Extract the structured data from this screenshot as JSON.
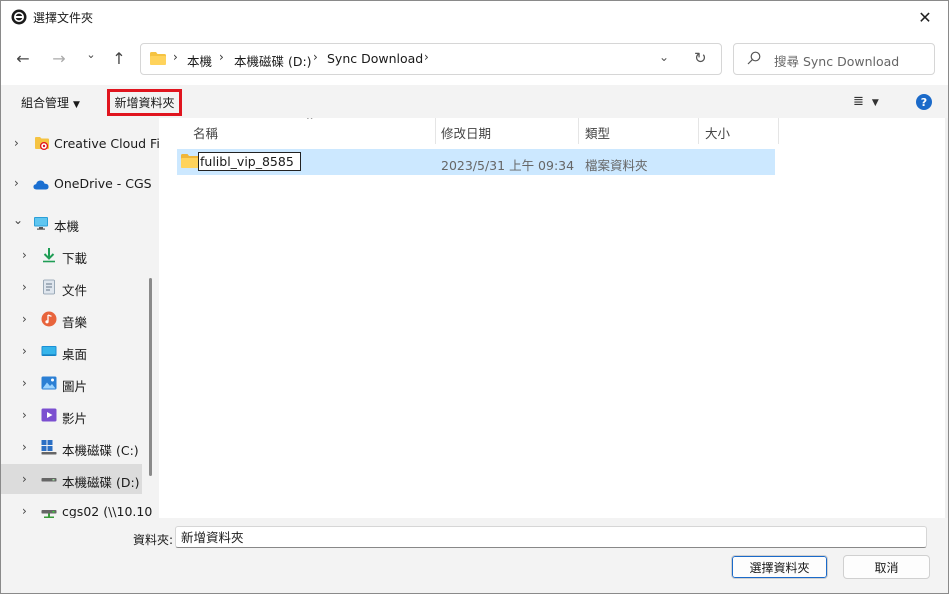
{
  "window": {
    "title": "選擇文件夾",
    "close_glyph": "✕"
  },
  "nav": {
    "back_glyph": "←",
    "forward_glyph": "→",
    "recent_glyph": "⌄",
    "up_glyph": "↑"
  },
  "address": {
    "crumbs": [
      "本機",
      "本機磁碟 (D:)",
      "Sync Download"
    ],
    "separator": "›",
    "dropdown_glyph": "⌄",
    "refresh_glyph": "↻"
  },
  "search": {
    "placeholder": "搜尋 Sync Download"
  },
  "toolbar": {
    "organize_label": "組合管理",
    "new_folder_label": "新增資料夾",
    "view_glyph": "≣",
    "caret_glyph": "▼",
    "help_glyph": "?"
  },
  "sidebar": {
    "chevron_closed": "›",
    "chevron_open": "⌄",
    "items": [
      {
        "label": "Creative Cloud Files",
        "icon": "creative-cloud-icon"
      },
      {
        "label": "OneDrive - CGS",
        "icon": "onedrive-icon"
      },
      {
        "label": "本機",
        "icon": "computer-icon"
      },
      {
        "label": "下載",
        "icon": "download-icon"
      },
      {
        "label": "文件",
        "icon": "documents-icon"
      },
      {
        "label": "音樂",
        "icon": "music-icon"
      },
      {
        "label": "桌面",
        "icon": "desktop-icon"
      },
      {
        "label": "圖片",
        "icon": "pictures-icon"
      },
      {
        "label": "影片",
        "icon": "videos-icon"
      },
      {
        "label": "本機磁碟 (C:)",
        "icon": "windows-drive-icon"
      },
      {
        "label": "本機磁碟 (D:)",
        "icon": "drive-icon"
      },
      {
        "label": "cgs02 (\\\\10.10",
        "icon": "network-drive-icon"
      }
    ]
  },
  "columns": {
    "name": "名稱",
    "modified": "修改日期",
    "type": "類型",
    "size": "大小",
    "sort_glyph": "^"
  },
  "files": [
    {
      "name": "fulibl_vip_8585",
      "modified": "2023/5/31 上午 09:34",
      "type": "檔案資料夾",
      "size": ""
    }
  ],
  "footer": {
    "folder_label": "資料夾:",
    "folder_value": "新增資料夾",
    "select_button": "選擇資料夾",
    "cancel_button": "取消"
  },
  "colors": {
    "accent": "#1b6ac9",
    "selection": "#cce8ff",
    "highlight_box": "#e0141e",
    "folder": "#f5c342"
  }
}
